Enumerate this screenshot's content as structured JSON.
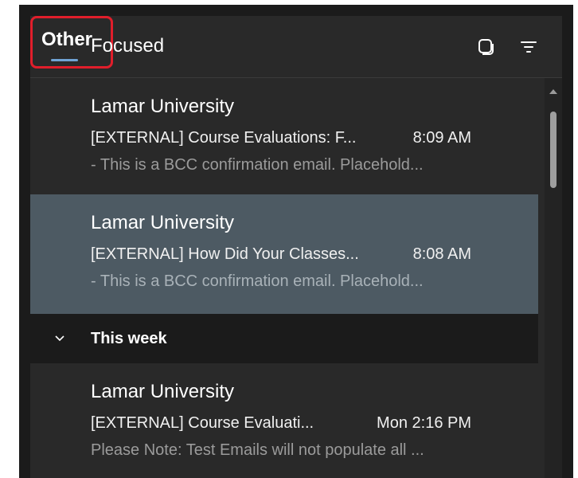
{
  "tabs": {
    "focused": "Focused",
    "other": "Other"
  },
  "header_icons": [
    "copy-icon",
    "filter-icon"
  ],
  "mails": [
    {
      "sender": "Lamar University",
      "subject": "[EXTERNAL] Course Evaluations: F...",
      "time": "8:09 AM",
      "preview": "- This is a BCC confirmation email. Placehold..."
    },
    {
      "sender": "Lamar University",
      "subject": "[EXTERNAL] How Did Your Classes...",
      "time": "8:08 AM",
      "preview": "- This is a BCC confirmation email. Placehold..."
    },
    {
      "sender": "Lamar University",
      "subject": "[EXTERNAL] Course Evaluati...",
      "time": "Mon 2:16 PM",
      "preview": "Please Note: Test Emails will not populate all ..."
    }
  ],
  "section": {
    "title": "This week"
  },
  "colors": {
    "highlight_border": "#e01e2b",
    "tab_underline": "#6fa3d4",
    "selected_row": "#4d5a63",
    "background": "#292929"
  }
}
